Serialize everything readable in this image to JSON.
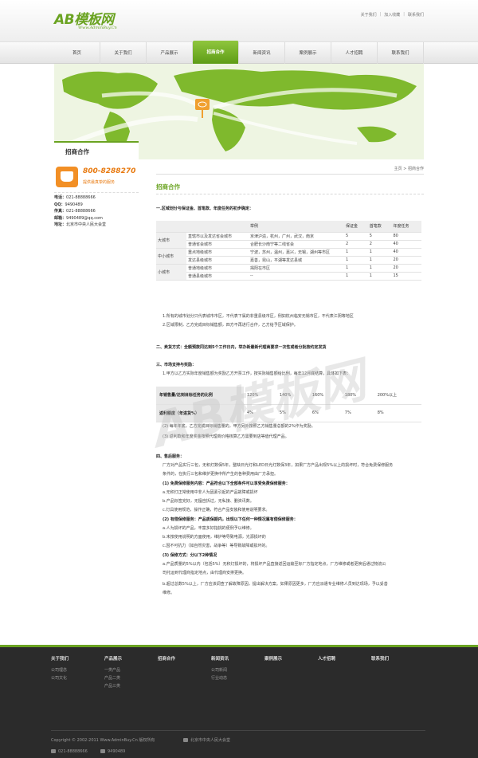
{
  "header": {
    "logo_text": "AB模板网",
    "logo_sub": "Www.AdminBuy.Cn",
    "top_links": [
      "关于我们",
      "加入收藏",
      "联系我们"
    ]
  },
  "nav": [
    "首页",
    "关于我们",
    "产品展示",
    "招商合作",
    "新闻资讯",
    "案例展示",
    "人才招聘",
    "联系我们"
  ],
  "nav_active": "招商合作",
  "sidebar": {
    "title": "招商合作",
    "phone": "800-8288270",
    "phone_sub": "提供最真挚的服务",
    "contacts": [
      {
        "label": "电话：",
        "value": "021-88888666"
      },
      {
        "label": "QQ：",
        "value": "9490489"
      },
      {
        "label": "传真：",
        "value": "021-88888666"
      },
      {
        "label": "邮箱：",
        "value": "9490489@qq.com"
      },
      {
        "label": "地址：",
        "value": "北京市中央人民大会堂"
      }
    ]
  },
  "main": {
    "breadcrumb": "主页 > 招商合作",
    "title": "招商合作",
    "sec1": "一.区域划分与保证金、首笔款、年度任务的初步确定：",
    "table1": {
      "headers": [
        "",
        "举例",
        "",
        "保证金",
        "首笔款",
        "年度任务"
      ],
      "groups": [
        {
          "name": "大城市",
          "rows": [
            [
              "直辖市以及发达省会城市",
              "京津沪渝，杭州，广州，武汉，南京",
              "5",
              "5",
              "80"
            ],
            [
              "普通省会城市",
              "合肥长沙南宁等二线省会",
              "2",
              "2",
              "40"
            ]
          ]
        },
        {
          "name": "中小城市",
          "rows": [
            [
              "重点地级城市",
              "宁波，苏州，温州，嘉兴，无锡，湖州等市区",
              "1",
              "1",
              "40"
            ],
            [
              "发达县级城市",
              "嘉善，昆山，平湖等发达县城",
              "1",
              "1",
              "20"
            ]
          ]
        },
        {
          "name": "小城市",
          "rows": [
            [
              "普通地级城市",
              "揭阳在市区",
              "1",
              "1",
              "20"
            ],
            [
              "普通县级城市",
              "--",
              "1",
              "1",
              "15"
            ]
          ]
        }
      ]
    },
    "notes1": [
      "1.所有的城市划分只代表城市市区，不代表下属的非重县级市区，例如杭州临安无锡市区，不代表江阴等地区",
      "2.区域限制，乙方完成目标销售额，四方不再进行合作，乙方给予区域保护。"
    ],
    "sec2": "二、卖货方式：全额预款同达到5个工作日内，举办新最新代理商要求一次性或者分批按约定发货",
    "sec3": "三、市场支持与奖励：",
    "sec3_text": "1.甲方以乙方实际年度销售额为奖励乙方开票工作，按实际销售额给比例，每年12月底结算，具体如下表：",
    "table2": {
      "rows": [
        {
          "head": "年销售量/达到目标任务的比例",
          "cells": [
            "120%",
            "140%",
            "160%",
            "180%",
            "200%以上"
          ]
        },
        {
          "head": "返利额度（年进货%）",
          "cells": [
            "4%",
            "5%",
            "6%",
            "7%",
            "8%"
          ]
        }
      ]
    },
    "notes2": [
      "(2) 每年年底，乙方完成目标销售量的，甲方另外按照乙方销售量总额的2%作为奖励。",
      "(3) 返利款和年度奖金按照代理商价格核算乙方需要到店等值代理产品。"
    ],
    "sec4": "四、售后服务：",
    "service_lines": [
      "厂方对产品实行三包，无积灯数保5年，整缺日光灯和LED日光灯数保3年，如果厂方产品出现5%以上的损坏时，符合免费保修服务",
      "条件的，在执行三包和维护更换中所产生的各种费用由厂方承担。",
      "(1) 免费保修服务内容：产品符合以下全部条件可以享受免费保修服务：",
      "a.无积灯正常使用中非人为因素引起的产品故障或损坏",
      "b.产品标签完好，无擅自拆过，无私接、删资讯数。",
      "c.灯具使用规范，操作正确，符合产品安装和使用说明要求。",
      "(2) 有偿保修服务：产品质保期内，出现以下任何一种情况属有偿保修服务：",
      "a.人为损坏的产品，丰富多好指挑的便例予以维修。",
      "b.未按使用说明的方面使用，维护等导致电源，光源损坏的",
      "c.因不可抗力（如自然灾害，战争等）等导致故障或损坏的。",
      "(3) 保修方式：分以下2种情况",
      "a.产品质量的5%以内（包括5%）无积灯损坏的，将损坏产品直接返回运输至标厂方指定地点，厂方维修或者更换后通过物流公",
      "司托运到代理商指定地点，由代理商安排更换。",
      "b.超过总数5%以上，厂方应该调查了解故障原因，提出解决方案。如果原因更多，厂方应派遣专业维修人员到达现场，予以妥善",
      "维修。"
    ]
  },
  "footer": {
    "columns": [
      {
        "head": "关于我们",
        "items": [
          "公司理念",
          "公司文化"
        ]
      },
      {
        "head": "产品展示",
        "items": [
          "一类产品",
          "产品二类",
          "产品三类"
        ]
      },
      {
        "head": "招商合作",
        "items": []
      },
      {
        "head": "新闻资讯",
        "items": [
          "公司新闻",
          "行业动态"
        ]
      },
      {
        "head": "案例展示",
        "items": []
      },
      {
        "head": "人才招聘",
        "items": []
      },
      {
        "head": "联系我们",
        "items": []
      }
    ],
    "copyright": "Copyright © 2002-2011 Www.AdminBuy.Cn 版权所有",
    "address": "北京市中央人民大会堂",
    "tel": "021-88888666",
    "qq": "9490489"
  },
  "watermark": "AB模板网",
  "colors": {
    "accent": "#6aa321",
    "orange": "#e87a10",
    "footer_bg": "#2b2b2b"
  }
}
